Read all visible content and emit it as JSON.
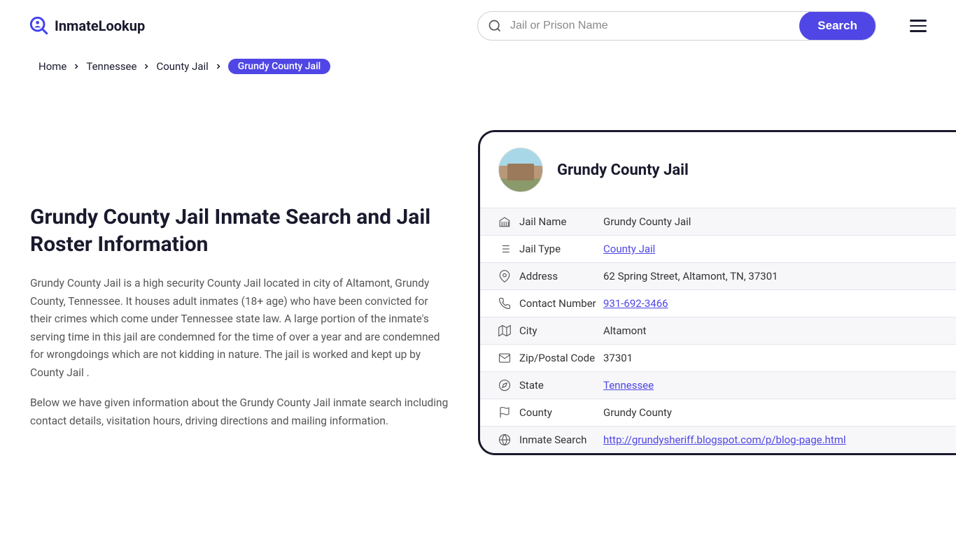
{
  "logo": {
    "text": "InmateLookup"
  },
  "search": {
    "placeholder": "Jail or Prison Name",
    "button": "Search"
  },
  "breadcrumbs": {
    "items": [
      "Home",
      "Tennessee",
      "County Jail"
    ],
    "current": "Grundy County Jail"
  },
  "page": {
    "title": "Grundy County Jail Inmate Search and Jail Roster Information",
    "desc1": "Grundy County Jail is a high security County Jail located in city of Altamont, Grundy County, Tennessee. It houses adult inmates (18+ age) who have been convicted for their crimes which come under Tennessee state law. A large portion of the inmate's serving time in this jail are condemned for the time of over a year and are condemned for wrongdoings which are not kidding in nature. The jail is worked and kept up by County Jail .",
    "desc2": "Below we have given information about the Grundy County Jail inmate search including contact details, visitation hours, driving directions and mailing information."
  },
  "card": {
    "title": "Grundy County Jail",
    "rows": {
      "jail_name": {
        "label": "Jail Name",
        "value": "Grundy County Jail"
      },
      "jail_type": {
        "label": "Jail Type",
        "value": "County Jail"
      },
      "address": {
        "label": "Address",
        "value": "62 Spring Street, Altamont, TN, 37301"
      },
      "contact": {
        "label": "Contact Number",
        "value": "931-692-3466"
      },
      "city": {
        "label": "City",
        "value": "Altamont"
      },
      "zip": {
        "label": "Zip/Postal Code",
        "value": "37301"
      },
      "state": {
        "label": "State",
        "value": "Tennessee"
      },
      "county": {
        "label": "County",
        "value": "Grundy County"
      },
      "inmate_search": {
        "label": "Inmate Search",
        "value": "http://grundysheriff.blogspot.com/p/blog-page.html"
      }
    }
  }
}
